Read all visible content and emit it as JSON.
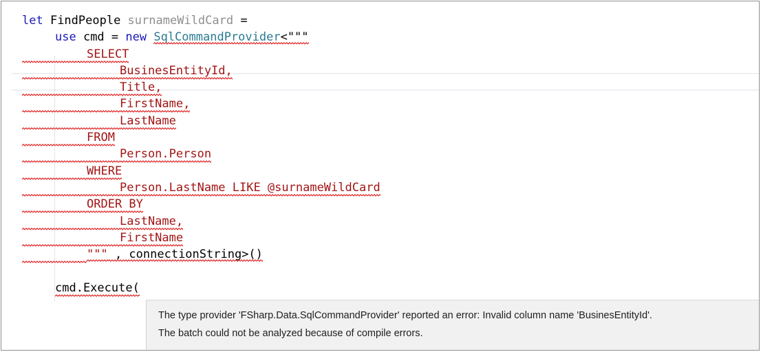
{
  "code": {
    "l1": {
      "kw": "let",
      "name": " FindPeople",
      "param": " surnameWildCard",
      "eq": " ="
    },
    "l2": {
      "kw1": "use",
      "mid": " cmd = ",
      "kw2": "new",
      "sp": " ",
      "type": "SqlCommandProvider",
      "open": "<\"\"\""
    },
    "sql": {
      "select": "SELECT",
      "col1": "BusinesEntityId,",
      "col2": "Title,",
      "col3": "FirstName,",
      "col4": "LastName",
      "from": "FROM",
      "table": "Person.Person",
      "where": "WHERE",
      "cond": "Person.LastName LIKE @surnameWildCard",
      "orderby": "ORDER BY",
      "ord1": "LastName,",
      "ord2": "FirstName"
    },
    "close": {
      "quotes": "\"\"\"",
      "rest": " , connectionString>()"
    },
    "exec": "cmd.Execute("
  },
  "tooltip": {
    "line1": "The type provider 'FSharp.Data.SqlCommandProvider' reported an error: Invalid column name 'BusinesEntityId'.",
    "line2": "The batch could not be analyzed because of compile errors."
  }
}
